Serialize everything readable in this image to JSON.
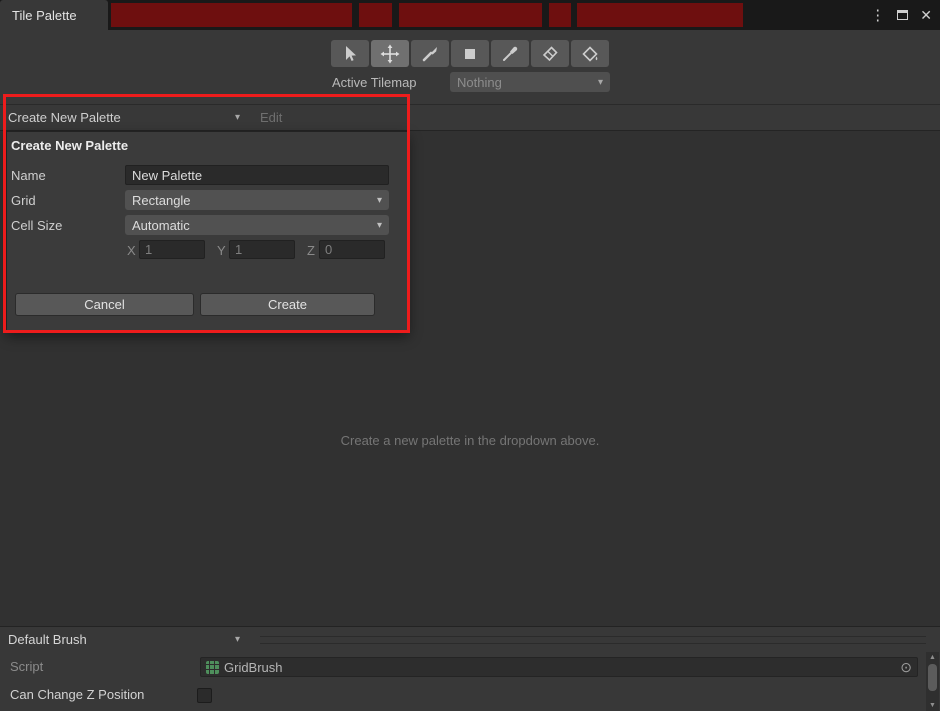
{
  "window": {
    "tab_title": "Tile Palette"
  },
  "icons": {
    "kebab": "⋮",
    "close": "✕",
    "dropdown_arrow": "▾",
    "object_picker": "⊙",
    "scroll_up": "▲",
    "scroll_down": "▼"
  },
  "toolbar": {
    "tools": [
      "select",
      "move",
      "brush",
      "box-fill",
      "picker",
      "eraser",
      "fill"
    ],
    "selected_tool": "move",
    "active_tilemap_label": "Active Tilemap",
    "active_tilemap_value": "Nothing"
  },
  "palette_bar": {
    "dropdown_value": "Create New Palette",
    "edit_label": "Edit"
  },
  "create_popup": {
    "title": "Create New Palette",
    "name_label": "Name",
    "name_value": "New Palette",
    "grid_label": "Grid",
    "grid_value": "Rectangle",
    "cell_size_label": "Cell Size",
    "cell_size_value": "Automatic",
    "x_label": "X",
    "x_value": "1",
    "y_label": "Y",
    "y_value": "1",
    "z_label": "Z",
    "z_value": "0",
    "cancel_label": "Cancel",
    "create_label": "Create"
  },
  "main_area": {
    "empty_message": "Create a new palette in the dropdown above."
  },
  "brush_panel": {
    "brush_dropdown_value": "Default Brush",
    "script_label": "Script",
    "script_value": "GridBrush",
    "can_change_z_label": "Can Change Z Position",
    "can_change_z_checked": false
  },
  "colors": {
    "annotation_red": "#ee1c1c",
    "redaction_red": "#6e0f0f",
    "panel_bg": "#383838",
    "field_bg": "#2a2a2a"
  }
}
